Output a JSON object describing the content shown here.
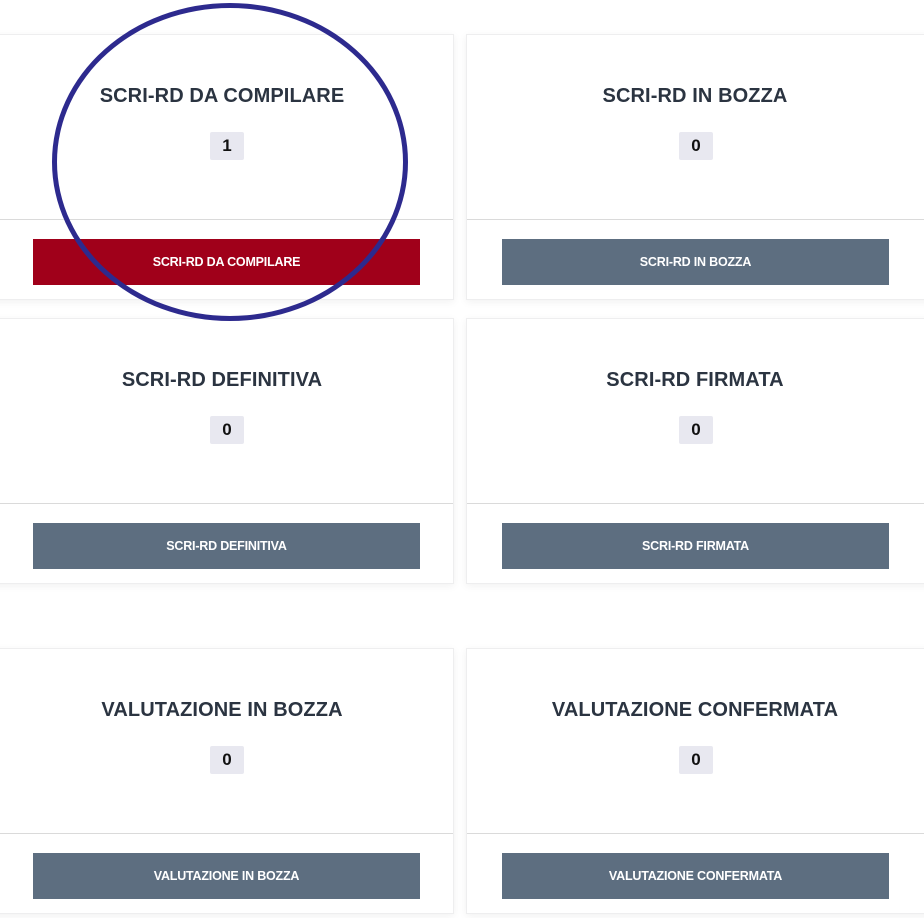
{
  "cards": [
    {
      "title": "SCRI-RD DA COMPILARE",
      "count": "1",
      "button_label": "SCRI-RD DA COMPILARE",
      "button_color": "#a0001a"
    },
    {
      "title": "SCRI-RD IN BOZZA",
      "count": "0",
      "button_label": "SCRI-RD IN BOZZA",
      "button_color": "#5d6e80"
    },
    {
      "title": "SCRI-RD DEFINITIVA",
      "count": "0",
      "button_label": "SCRI-RD DEFINITIVA",
      "button_color": "#5d6e80"
    },
    {
      "title": "SCRI-RD FIRMATA",
      "count": "0",
      "button_label": "SCRI-RD FIRMATA",
      "button_color": "#5d6e80"
    },
    {
      "title": "VALUTAZIONE IN BOZZA",
      "count": "0",
      "button_label": "VALUTAZIONE IN BOZZA",
      "button_color": "#5d6e80"
    },
    {
      "title": "VALUTAZIONE CONFERMATA",
      "count": "0",
      "button_label": "VALUTAZIONE CONFERMATA",
      "button_color": "#5d6e80"
    }
  ],
  "annotation": {
    "shape": "circle",
    "color": "#2d2a8e",
    "target": "SCRI-RD DA COMPILARE"
  }
}
